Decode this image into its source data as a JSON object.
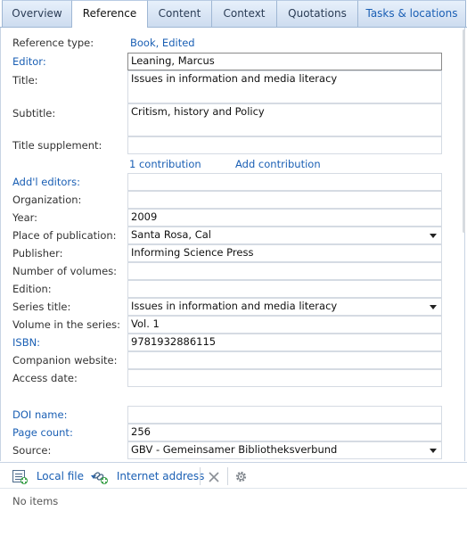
{
  "tabs": [
    {
      "label": "Overview"
    },
    {
      "label": "Reference"
    },
    {
      "label": "Content"
    },
    {
      "label": "Context"
    },
    {
      "label": "Quotations"
    },
    {
      "label": "Tasks & locations"
    }
  ],
  "reference": {
    "type_label": "Reference type:",
    "type_value": "Book, Edited",
    "editor_label": "Editor:",
    "editor_value": "Leaning, Marcus",
    "title_label": "Title:",
    "title_value": "Issues in information and media literacy",
    "subtitle_label": "Subtitle:",
    "subtitle_value": "Critism, history and Policy",
    "title_supplement_label": "Title supplement:",
    "title_supplement_value": "",
    "contribution_count": "1 contribution",
    "add_contribution": "Add contribution",
    "addl_editors_label": "Add'l editors:",
    "addl_editors_value": "",
    "organization_label": "Organization:",
    "organization_value": "",
    "year_label": "Year:",
    "year_value": "2009",
    "place_label": "Place of publication:",
    "place_value": "Santa Rosa, Cal",
    "publisher_label": "Publisher:",
    "publisher_value": "Informing Science Press",
    "num_volumes_label": "Number of volumes:",
    "num_volumes_value": "",
    "edition_label": "Edition:",
    "edition_value": "",
    "series_title_label": "Series title:",
    "series_title_value": "Issues in information and media literacy",
    "volume_series_label": "Volume in the series:",
    "volume_series_value": "Vol. 1",
    "isbn_label": "ISBN:",
    "isbn_value": "9781932886115",
    "companion_label": "Companion website:",
    "companion_value": "",
    "access_date_label": "Access date:",
    "access_date_value": "",
    "doi_label": "DOI name:",
    "doi_value": "",
    "page_count_label": "Page count:",
    "page_count_value": "256",
    "source_label": "Source:",
    "source_value": "GBV - Gemeinsamer Bibliotheksverbund"
  },
  "attachments": {
    "local_file": "Local file",
    "internet_address": "Internet address",
    "empty_text": "No items"
  },
  "icons": {
    "local_file": "file-add-icon",
    "internet_address": "link-add-icon",
    "delete": "close-icon",
    "settings": "gear-icon"
  },
  "colors": {
    "link": "#1a5fb4",
    "tab_gradient_top": "#e7f0fb",
    "tab_gradient_bottom": "#cddcef",
    "border": "#9fb7d4"
  }
}
